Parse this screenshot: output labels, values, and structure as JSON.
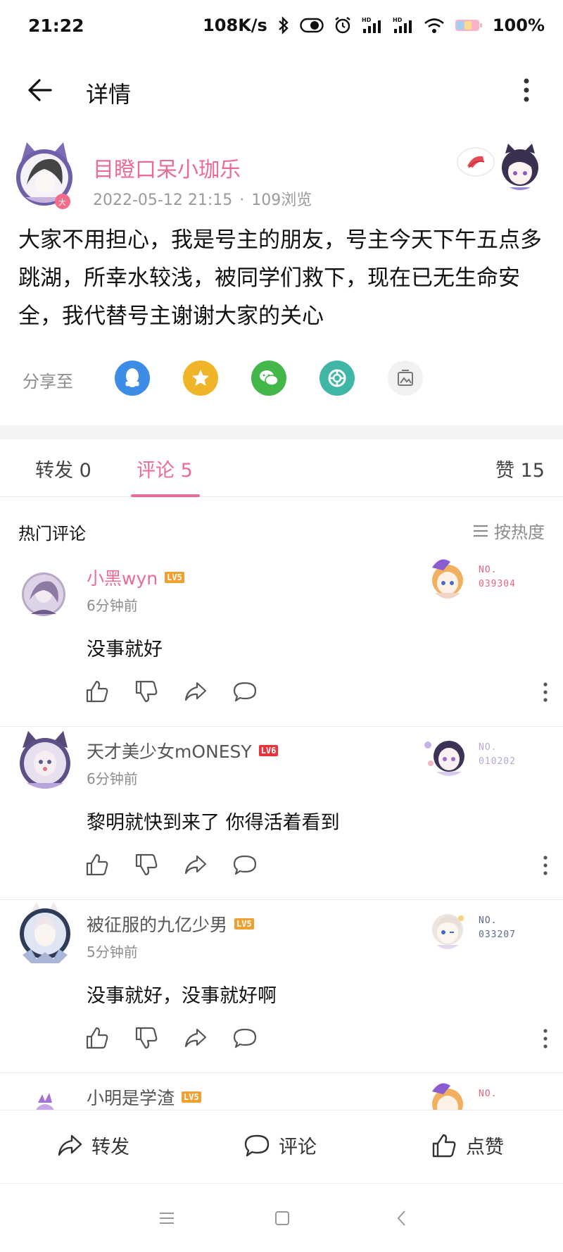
{
  "status_bar": {
    "time": "21:22",
    "speed": "108K/s",
    "battery": "100%"
  },
  "header": {
    "title": "详情"
  },
  "post": {
    "author": "目瞪口呆小珈乐",
    "date": "2022-05-12 21:15",
    "views": "109浏览",
    "body": "大家不用担心，我是号主的朋友，号主今天下午五点多跳湖，所幸水较浅，被同学们救下，现在已无生命安全，我代替号主谢谢大家的关心",
    "avatar_badge": "大"
  },
  "share": {
    "label": "分享至",
    "targets": [
      "qq-icon",
      "qzone-icon",
      "wechat-icon",
      "moments-icon",
      "image-share-icon"
    ]
  },
  "tabs": {
    "repost": "转发 0",
    "comments": "评论 5",
    "likes": "赞 15"
  },
  "comments_section": {
    "title": "热门评论",
    "sort_label": "按热度"
  },
  "comments": [
    {
      "name": "小黑wyn",
      "level": "LV5",
      "time": "6分钟前",
      "text": "没事就好",
      "badge_no": "NO.",
      "badge_num": "039304"
    },
    {
      "name": "天才美少女mONESY",
      "level": "LV6",
      "time": "6分钟前",
      "text": "黎明就快到来了 你得活着看到",
      "badge_no": "NO.",
      "badge_num": "010202"
    },
    {
      "name": "被征服的九亿少男",
      "level": "LV5",
      "time": "5分钟前",
      "text": "没事就好，没事就好啊",
      "badge_no": "NO.",
      "badge_num": "033207"
    },
    {
      "name": "小明是学渣",
      "level": "LV5",
      "badge_no": "NO."
    }
  ],
  "bottom_bar": {
    "repost": "转发",
    "comment": "评论",
    "like": "点赞"
  },
  "colors": {
    "accent": "#ea6b97",
    "lv5": "#f0a030",
    "lv6": "#e8343a"
  }
}
